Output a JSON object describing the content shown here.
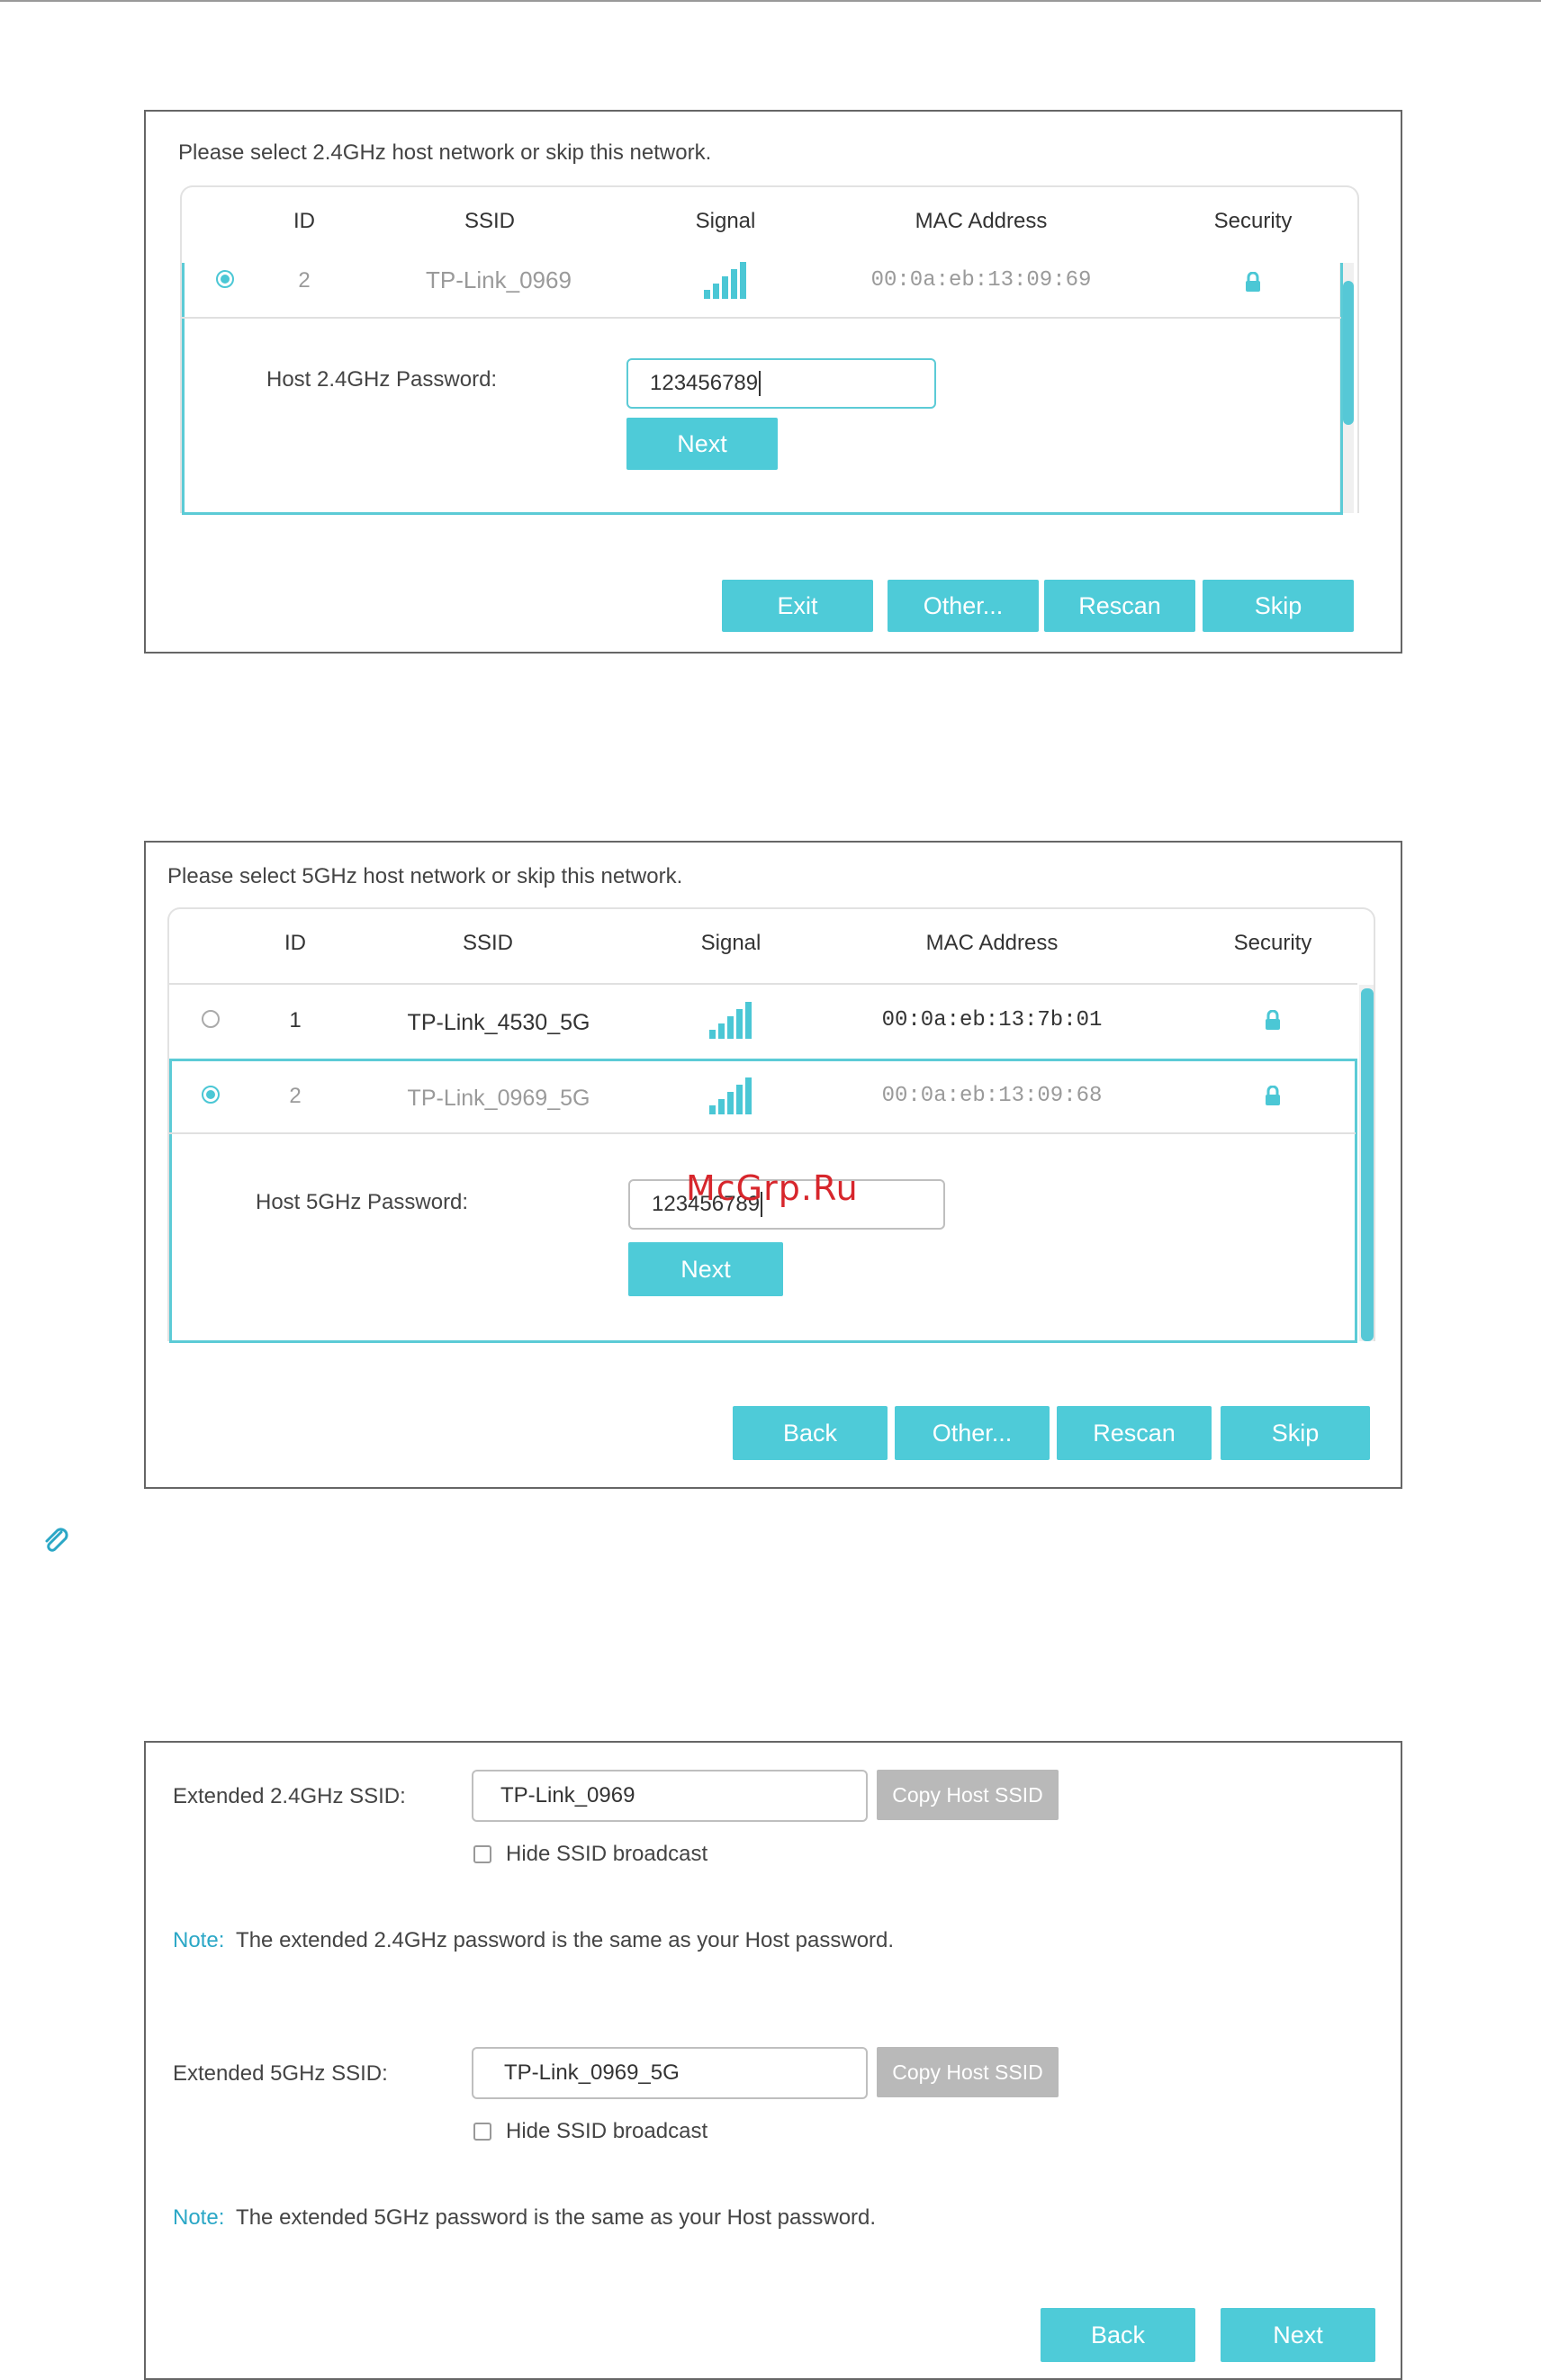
{
  "colors": {
    "accent": "#4ecbd8",
    "button_gray": "#b9b9b9",
    "note_key": "#2ba7c6",
    "watermark": "#d7262c"
  },
  "panel1": {
    "intro": "Please select 2.4GHz host network or skip this network.",
    "headers": {
      "id": "ID",
      "ssid": "SSID",
      "signal": "Signal",
      "mac": "MAC Address",
      "security": "Security"
    },
    "rows": [
      {
        "id": "2",
        "ssid": "TP-Link_0969",
        "mac": "00:0a:eb:13:09:69",
        "selected": true,
        "icon_signal": "signal-icon",
        "icon_security": "lock-icon"
      }
    ],
    "password_label": "Host 2.4GHz Password:",
    "password_value": "123456789",
    "next": "Next",
    "buttons": {
      "exit": "Exit",
      "other": "Other...",
      "rescan": "Rescan",
      "skip": "Skip"
    }
  },
  "panel2": {
    "intro": "Please select 5GHz host network or skip this network.",
    "headers": {
      "id": "ID",
      "ssid": "SSID",
      "signal": "Signal",
      "mac": "MAC Address",
      "security": "Security"
    },
    "rows": [
      {
        "id": "1",
        "ssid": "TP-Link_4530_5G",
        "mac": "00:0a:eb:13:7b:01",
        "selected": false,
        "icon_signal": "signal-icon",
        "icon_security": "lock-icon"
      },
      {
        "id": "2",
        "ssid": "TP-Link_0969_5G",
        "mac": "00:0a:eb:13:09:68",
        "selected": true,
        "icon_signal": "signal-icon",
        "icon_security": "lock-icon"
      }
    ],
    "password_label": "Host 5GHz Password:",
    "password_value": "123456789",
    "next": "Next",
    "buttons": {
      "back": "Back",
      "other": "Other...",
      "rescan": "Rescan",
      "skip": "Skip"
    }
  },
  "watermark": "McGrp.Ru",
  "note_icon": "paperclip-icon",
  "panel3": {
    "ssid24_label": "Extended 2.4GHz SSID:",
    "ssid24_value": "TP-Link_0969",
    "copy_label": "Copy Host SSID",
    "hide_label": "Hide SSID broadcast",
    "note_key": "Note:",
    "note24": "The extended 2.4GHz password is the same as your Host password.",
    "ssid5_label": "Extended 5GHz SSID:",
    "ssid5_value": "TP-Link_0969_5G",
    "note5": "The extended 5GHz password is the same as your Host password.",
    "buttons": {
      "back": "Back",
      "next": "Next"
    }
  }
}
